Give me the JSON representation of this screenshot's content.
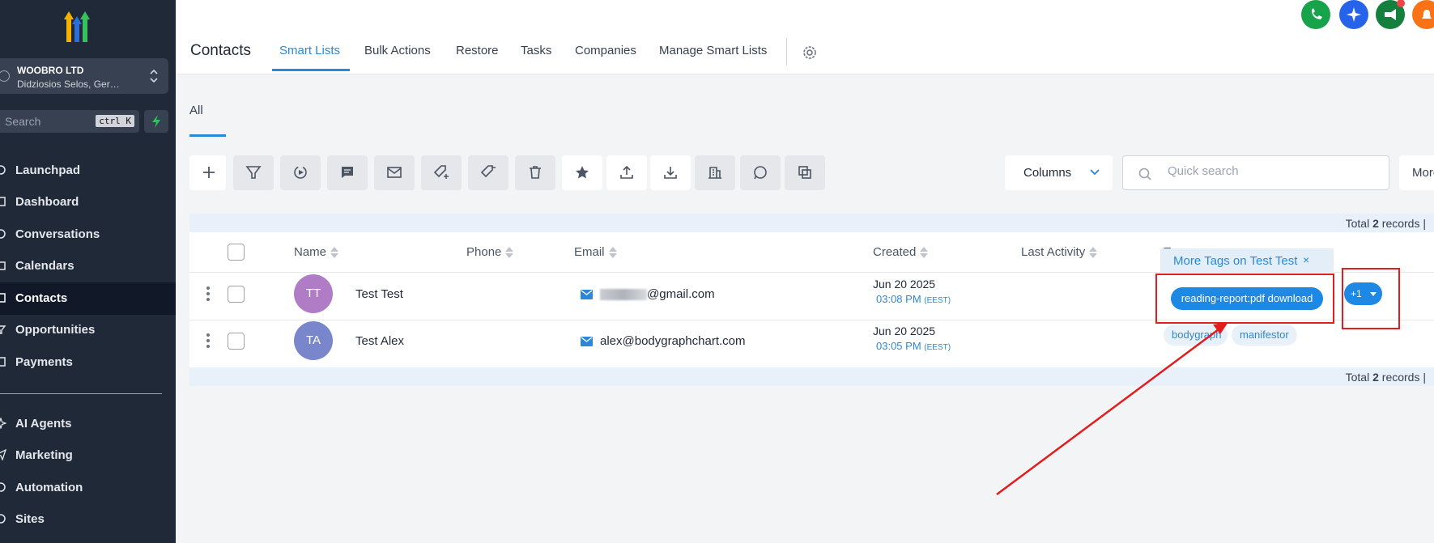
{
  "sidebar": {
    "account": {
      "name": "WOOBRO LTD",
      "subtitle": "Didziosios Selos, Germany"
    },
    "search": {
      "placeholder": "Search",
      "shortcut": "ctrl K"
    },
    "items": [
      {
        "label": "Launchpad",
        "icon": "rocket-icon"
      },
      {
        "label": "Dashboard",
        "icon": "dashboard-icon"
      },
      {
        "label": "Conversations",
        "icon": "chat-icon"
      },
      {
        "label": "Calendars",
        "icon": "calendar-icon"
      },
      {
        "label": "Contacts",
        "icon": "contacts-icon",
        "active": true
      },
      {
        "label": "Opportunities",
        "icon": "filter-icon"
      },
      {
        "label": "Payments",
        "icon": "payments-icon"
      },
      {
        "label": "AI Agents",
        "icon": "sparkle-icon"
      },
      {
        "label": "Marketing",
        "icon": "send-icon"
      },
      {
        "label": "Automation",
        "icon": "automation-icon"
      },
      {
        "label": "Sites",
        "icon": "globe-icon"
      }
    ]
  },
  "header": {
    "title": "Contacts",
    "tabs": [
      "Smart Lists",
      "Bulk Actions",
      "Restore",
      "Tasks",
      "Companies",
      "Manage Smart Lists"
    ],
    "active_tab": "Smart Lists"
  },
  "subtabs": {
    "all": "All"
  },
  "toolbar": {
    "columns_label": "Columns",
    "search_placeholder": "Quick search",
    "more_label": "More"
  },
  "table": {
    "total_top": "Total 2 records |",
    "total_bottom": "Total 2 records |",
    "columns": [
      "Name",
      "Phone",
      "Email",
      "Created",
      "Last Activity",
      "Tags"
    ],
    "rows": [
      {
        "initials": "TT",
        "name": "Test Test",
        "email_suffix": "@gmail.com",
        "created_date": "Jun 20 2025",
        "created_time": "03:08 PM",
        "tz": "(EEST)"
      },
      {
        "initials": "TA",
        "name": "Test Alex",
        "email": "alex@bodygraphchart.com",
        "created_date": "Jun 20 2025",
        "created_time": "03:05 PM",
        "tz": "(EEST)",
        "tags": [
          "bodygraph",
          "manifestor"
        ]
      }
    ]
  },
  "popover": {
    "title": "More Tags on Test Test",
    "close": "×",
    "tag": "reading-report:pdf download",
    "more_count": "+1"
  },
  "colors": {
    "sidebar_bg": "#1f2937",
    "accent": "#2b88d8",
    "tag_blue": "#1e88e5",
    "annotation_red": "#e11d1d",
    "avatar_tt": "#b07cc6",
    "avatar_ta": "#7986cb"
  }
}
